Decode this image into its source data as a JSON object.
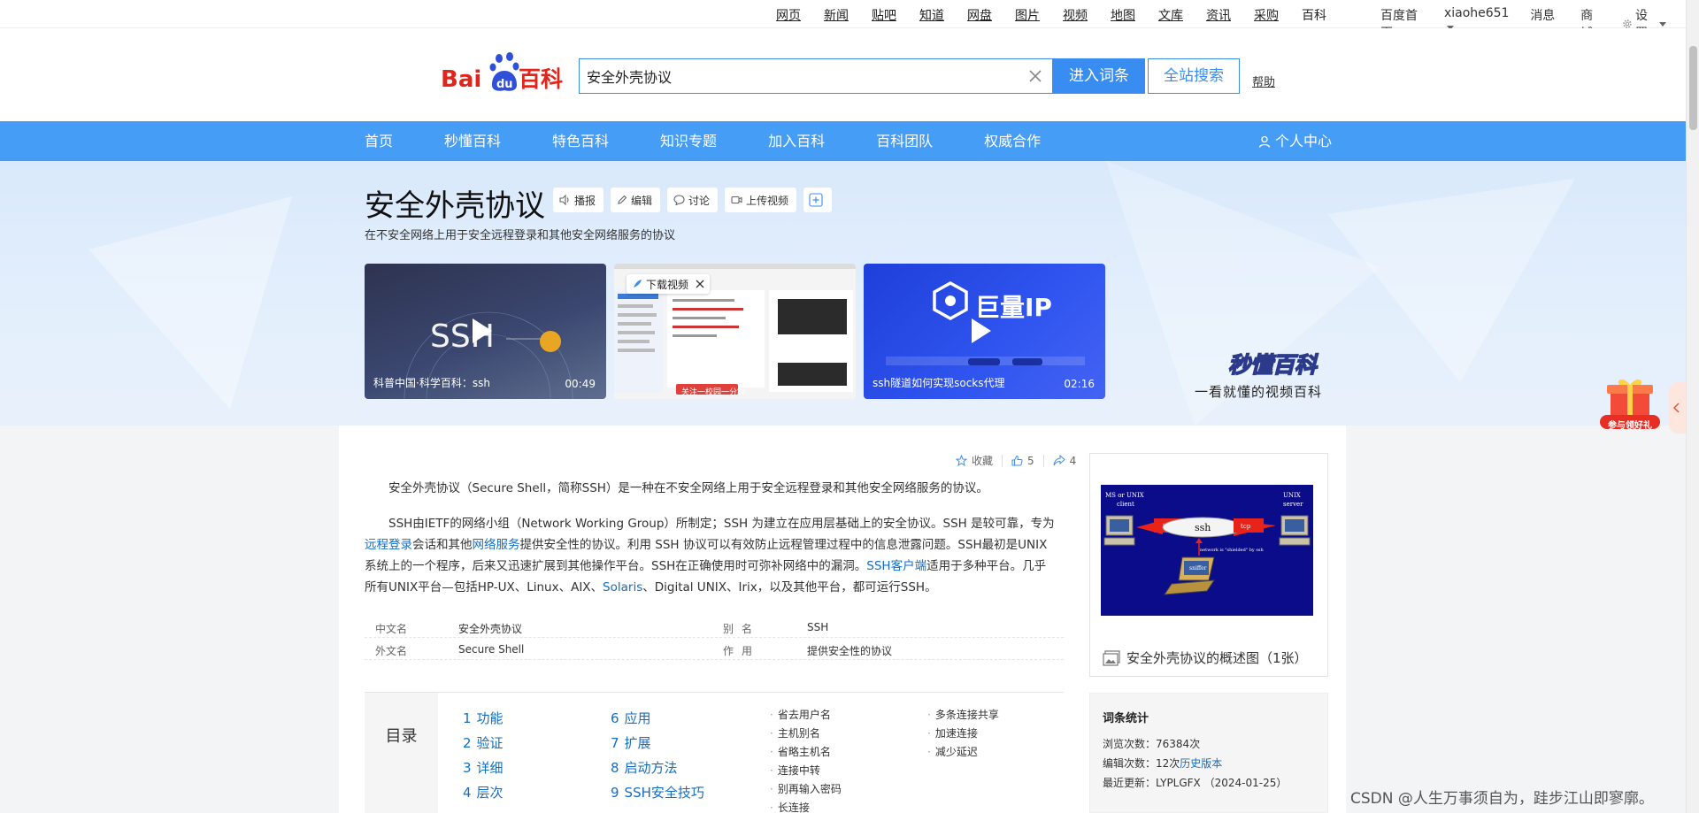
{
  "top_nav": {
    "links": [
      "网页",
      "新闻",
      "贴吧",
      "知道",
      "网盘",
      "图片",
      "视频",
      "地图",
      "文库",
      "资讯",
      "采购",
      "百科"
    ],
    "right": {
      "home": "百度首页",
      "user": "xiaohe651",
      "messages": "消息",
      "mall": "商城",
      "settings": "设置"
    }
  },
  "header": {
    "logo_text": "Baidu百科",
    "search_value": "安全外壳协议",
    "enter_label": "进入词条",
    "site_search_label": "全站搜索",
    "help_label": "帮助"
  },
  "nav": {
    "items": [
      "首页",
      "秒懂百科",
      "特色百科",
      "知识专题",
      "加入百科",
      "百科团队",
      "权威合作"
    ],
    "user_center": "个人中心"
  },
  "entry": {
    "title": "安全外壳协议",
    "tools": {
      "broadcast": "播报",
      "edit": "编辑",
      "discuss": "讨论",
      "upload_video": "上传视频"
    },
    "subtitle": "在不安全网络上用于安全远程登录和其他安全网络服务的协议",
    "videos": [
      {
        "caption": "科普中国·科学百科：ssh",
        "duration": "00:49",
        "overlay": "SSH"
      },
      {
        "caption": "下载视频",
        "duration": "",
        "overlay": "关注一校园一分钟"
      },
      {
        "caption": "ssh隧道如何实现socks代理",
        "duration": "02:16",
        "overlay": "巨量IP"
      }
    ],
    "miaodong": "秒懂百科",
    "slogan": "一看就懂的视频百科"
  },
  "actions": {
    "collect": "收藏",
    "likes": "5",
    "shares": "4"
  },
  "summary": {
    "p1": "安全外壳协议（Secure Shell，简称SSH）是一种在不安全网络上用于安全远程登录和其他安全网络服务的协议。",
    "p2_a": "SSH由IETF的网络小组（Network Working Group）所制定；SSH 为建立在应用层基础上的安全协议。SSH 是较可靠，专为",
    "p2_link1": "远程登录",
    "p2_b": "会话和其他",
    "p2_link2": "网络服务",
    "p2_c": "提供安全性的协议。利用 SSH 协议可以有效防止远程管理过程中的信息泄露问题。SSH最初是UNIX系统上的一个程序，后来又迅速扩展到其他操作平台。SSH在正确使用时可弥补网络中的漏洞。",
    "p2_link3": "SSH客户端",
    "p2_d": "适用于多种平台。几乎所有UNIX平台—包括HP-UX、Linux、AIX、",
    "p2_link4": "Solaris",
    "p2_e": "、Digital UNIX、Irix，以及其他平台，都可运行SSH。"
  },
  "basic_info": [
    {
      "k1": "中文名",
      "v1": "安全外壳协议",
      "k2": "别名",
      "v2": "SSH"
    },
    {
      "k1": "外文名",
      "v1": "Secure Shell",
      "k2": "作用",
      "v2": "提供安全性的协议"
    }
  ],
  "toc": {
    "label": "目录",
    "col1": [
      {
        "n": "1",
        "t": "功能"
      },
      {
        "n": "2",
        "t": "验证"
      },
      {
        "n": "3",
        "t": "详细"
      },
      {
        "n": "4",
        "t": "层次"
      }
    ],
    "col2": [
      {
        "n": "6",
        "t": "应用"
      },
      {
        "n": "7",
        "t": "扩展"
      },
      {
        "n": "8",
        "t": "启动方法"
      },
      {
        "n": "9",
        "t": "SSH安全技巧"
      }
    ],
    "sub1": [
      "省去用户名",
      "主机别名",
      "省略主机名",
      "连接中转",
      "别再输入密码",
      "长连接"
    ],
    "sub2": [
      "多条连接共享",
      "加速连接",
      "减少延迟"
    ]
  },
  "figure": {
    "caption": "安全外壳协议的概述图（1张）",
    "labels": {
      "left_os": "MS or UNIX",
      "left_role": "client",
      "right_os": "UNIX",
      "right_role": "server",
      "tube": "ssh",
      "tcp": "tcp",
      "note": "network is \"shielded\" by ssh",
      "sniffer": "sniffer"
    }
  },
  "stats": {
    "title": "词条统计",
    "views_label": "浏览次数：",
    "views": "76384次",
    "edits_label": "编辑次数：",
    "edits": "12次",
    "history": "历史版本",
    "updated_label": "最近更新：",
    "updated": "LYPLGFX （2024-01-25）"
  },
  "gift_label": "参与领好礼",
  "watermark": "CSDN @人生万事须自为，跬步江山即寥廓。"
}
